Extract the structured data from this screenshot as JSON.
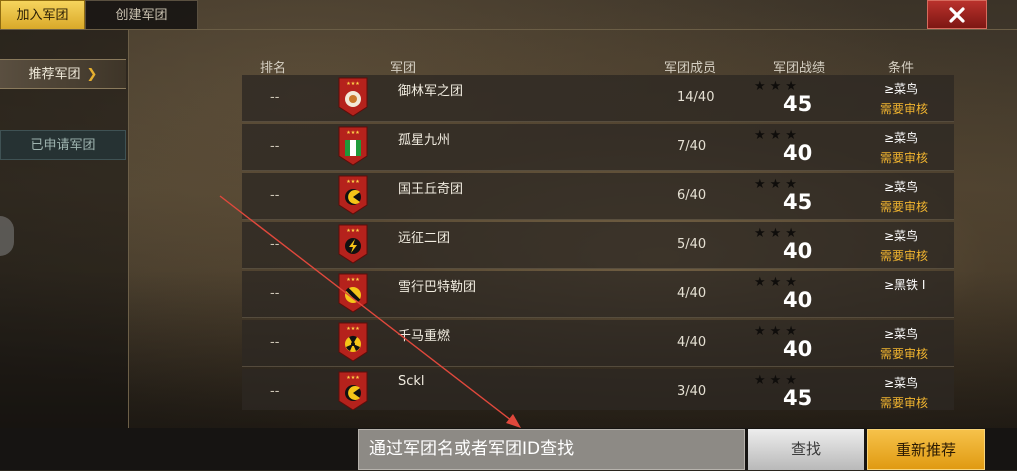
{
  "tabs": {
    "join": "加入军团",
    "create": "创建军团"
  },
  "side": {
    "recommended": "推荐军团",
    "chev": "❯",
    "applied": "已申请军团"
  },
  "headers": {
    "rank": "排名",
    "legion": "军团",
    "members": "军团成员",
    "record": "军团战绩",
    "condition": "条件"
  },
  "rows": [
    {
      "rank": "--",
      "name": "御林军之团",
      "members": "14/40",
      "stars": "★★★",
      "score": "45",
      "condition": "≥菜鸟",
      "requirement": "需要审核",
      "emblem": "lion-emblem-icon",
      "emblem_color": "#f2e9d8"
    },
    {
      "rank": "--",
      "name": "孤星九州",
      "members": "7/40",
      "stars": "★★★",
      "score": "40",
      "condition": "≥菜鸟",
      "requirement": "需要审核",
      "emblem": "flag-emblem-icon",
      "emblem_color": "#1f9a3a"
    },
    {
      "rank": "--",
      "name": "国王丘奇团",
      "members": "6/40",
      "stars": "★★★",
      "score": "45",
      "condition": "≥菜鸟",
      "requirement": "需要审核",
      "emblem": "pacman-emblem-icon",
      "emblem_color": "#f5c518"
    },
    {
      "rank": "--",
      "name": "远征二团",
      "members": "5/40",
      "stars": "★★★",
      "score": "40",
      "condition": "≥菜鸟",
      "requirement": "需要审核",
      "emblem": "lightning-emblem-icon",
      "emblem_color": "#f5c518"
    },
    {
      "rank": "--",
      "name": "雪行巴特勒团",
      "members": "4/40",
      "stars": "★★★",
      "score": "40",
      "condition": "≥黑铁 I",
      "requirement": "",
      "emblem": "stripe-emblem-icon",
      "emblem_color": "#f5c518"
    },
    {
      "rank": "--",
      "name": "千马重燃",
      "members": "4/40",
      "stars": "★★★",
      "score": "40",
      "condition": "≥菜鸟",
      "requirement": "需要审核",
      "emblem": "radiation-emblem-icon",
      "emblem_color": "#f5c518"
    },
    {
      "rank": "--",
      "name": "Sckl",
      "members": "3/40",
      "stars": "★★★",
      "score": "45",
      "condition": "≥菜鸟",
      "requirement": "需要审核",
      "emblem": "pacman-emblem-icon",
      "emblem_color": "#f5c518"
    }
  ],
  "search": {
    "placeholder": "通过军团名或者军团ID查找",
    "find": "查找",
    "refresh": "重新推荐"
  },
  "colors": {
    "accent": "#e6b02f",
    "close": "#b9322c",
    "emblem_bg": "#b5221c"
  }
}
